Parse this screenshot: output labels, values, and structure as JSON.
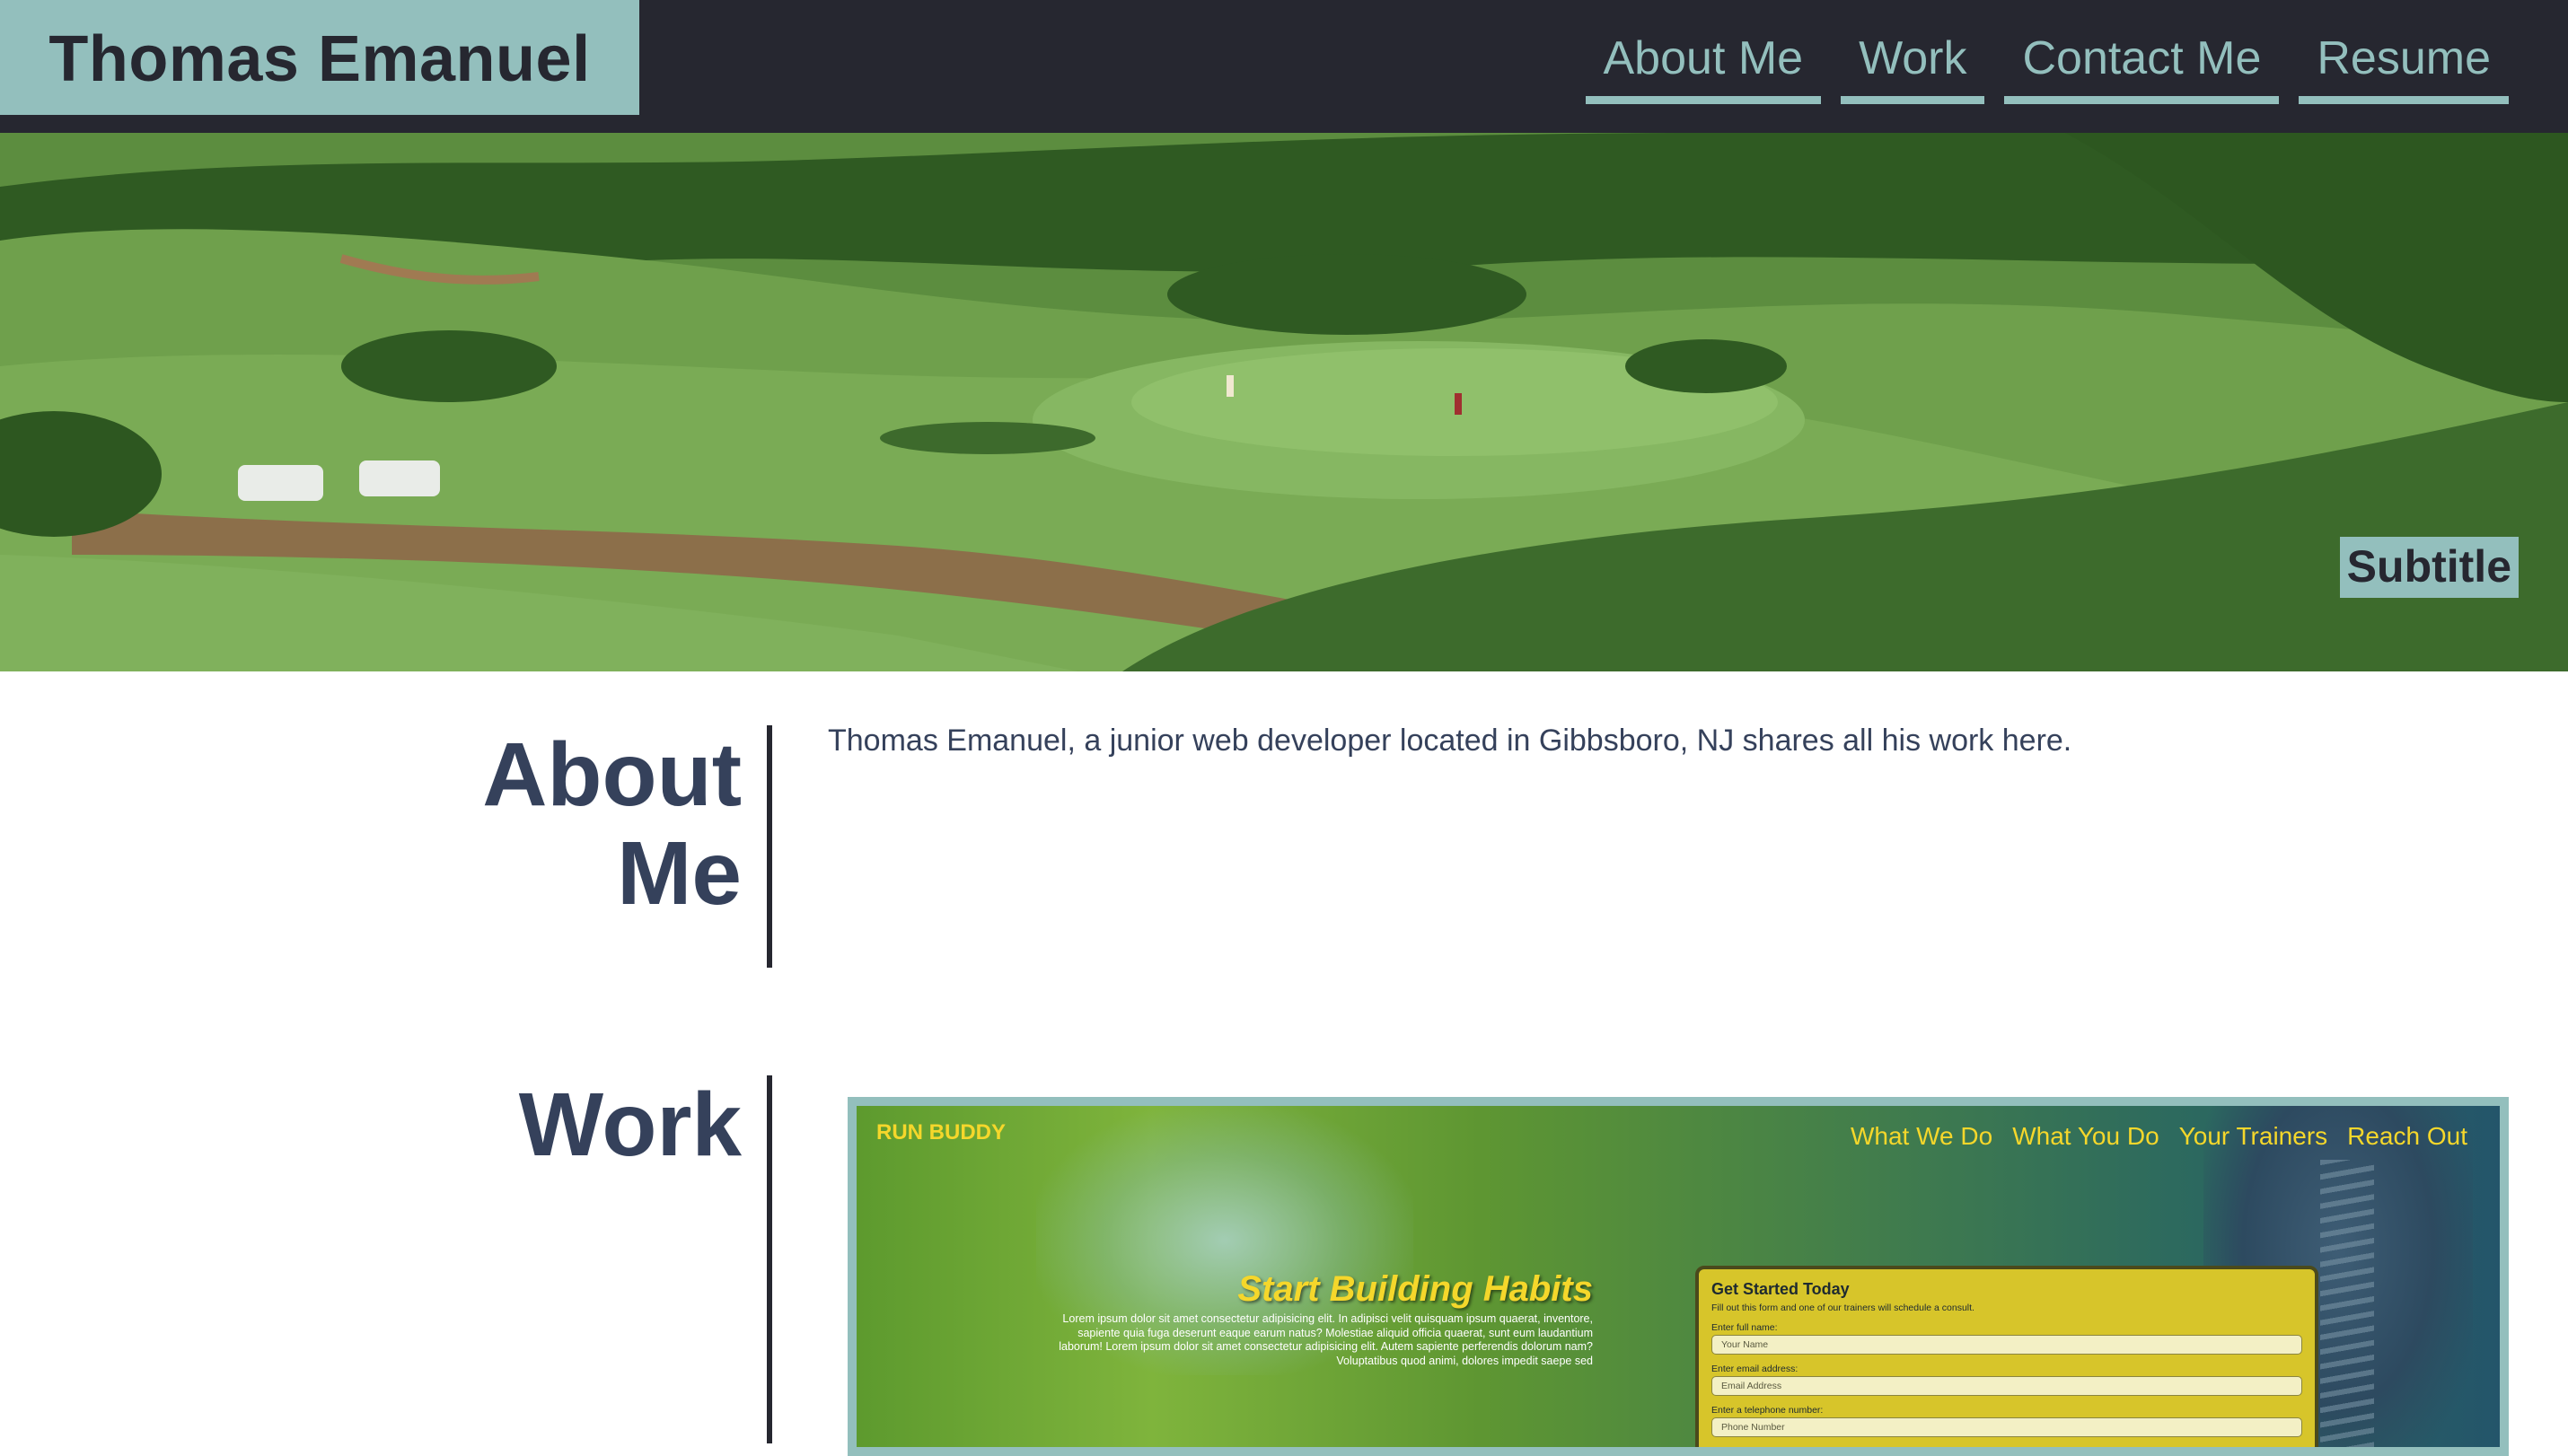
{
  "header": {
    "title": "Thomas Emanuel",
    "nav": [
      "About Me",
      "Work",
      "Contact Me",
      "Resume"
    ]
  },
  "hero": {
    "subtitle": "Subtitle"
  },
  "about": {
    "title_line1": "About",
    "title_line2": "Me",
    "text": "Thomas Emanuel, a junior web developer located in Gibbsboro, NJ shares all his work here."
  },
  "work": {
    "title": "Work",
    "project": {
      "logo": "RUN BUDDY",
      "nav": [
        "What We Do",
        "What You Do",
        "Your Trainers",
        "Reach Out"
      ],
      "hero_title": "Start Building Habits",
      "hero_text": "Lorem ipsum dolor sit amet consectetur adipisicing elit. In adipisci velit quisquam ipsum quaerat, inventore, sapiente quia fuga deserunt eaque earum natus? Molestiae aliquid officia quaerat, sunt eum laudantium laborum! Lorem ipsum dolor sit amet consectetur adipisicing elit. Autem sapiente perferendis dolorum nam? Voluptatibus quod animi, dolores impedit saepe sed",
      "form": {
        "title": "Get Started Today",
        "subtitle": "Fill out this form and one of our trainers will schedule a consult.",
        "fields": [
          {
            "label": "Enter full name:",
            "placeholder": "Your Name"
          },
          {
            "label": "Enter email address:",
            "placeholder": "Email Address"
          },
          {
            "label": "Enter a telephone number:",
            "placeholder": "Phone Number"
          }
        ]
      }
    }
  },
  "colors": {
    "header_bg": "#262730",
    "accent": "#93bfbd",
    "heading": "#35415b",
    "run_buddy_yellow": "#f5d72b"
  }
}
